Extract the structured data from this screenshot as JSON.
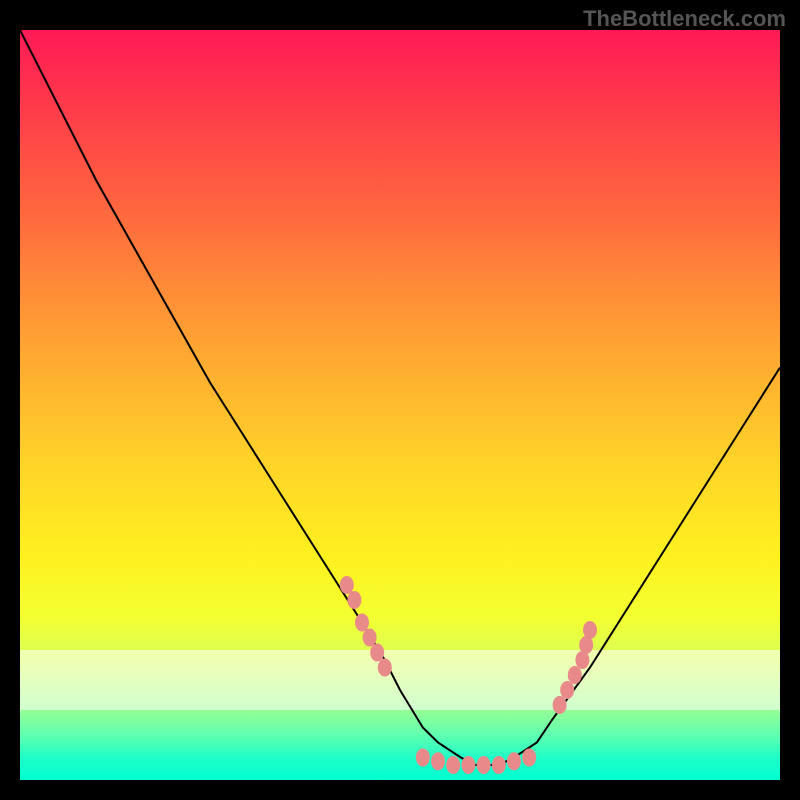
{
  "watermark": "TheBottleneck.com",
  "chart_data": {
    "type": "line",
    "title": "",
    "xlabel": "",
    "ylabel": "",
    "xlim": [
      0,
      100
    ],
    "ylim": [
      0,
      100
    ],
    "series": [
      {
        "name": "curve",
        "x": [
          0,
          5,
          10,
          15,
          20,
          25,
          30,
          35,
          40,
          45,
          48,
          50,
          53,
          55,
          58,
          60,
          63,
          65,
          68,
          70,
          75,
          80,
          85,
          90,
          95,
          100
        ],
        "y": [
          100,
          90,
          80,
          71,
          62,
          53,
          45,
          37,
          29,
          21,
          16,
          12,
          7,
          5,
          3,
          2,
          2,
          3,
          5,
          8,
          15,
          23,
          31,
          39,
          47,
          55
        ]
      }
    ],
    "marker_clusters": [
      {
        "name": "left-cluster",
        "points": [
          {
            "x": 43,
            "y": 26
          },
          {
            "x": 44,
            "y": 24
          },
          {
            "x": 45,
            "y": 21
          },
          {
            "x": 46,
            "y": 19
          },
          {
            "x": 47,
            "y": 17
          },
          {
            "x": 48,
            "y": 15
          }
        ]
      },
      {
        "name": "bottom-cluster",
        "points": [
          {
            "x": 53,
            "y": 3
          },
          {
            "x": 55,
            "y": 2.5
          },
          {
            "x": 57,
            "y": 2
          },
          {
            "x": 59,
            "y": 2
          },
          {
            "x": 61,
            "y": 2
          },
          {
            "x": 63,
            "y": 2
          },
          {
            "x": 65,
            "y": 2.5
          },
          {
            "x": 67,
            "y": 3
          }
        ]
      },
      {
        "name": "right-cluster",
        "points": [
          {
            "x": 71,
            "y": 10
          },
          {
            "x": 72,
            "y": 12
          },
          {
            "x": 73,
            "y": 14
          },
          {
            "x": 74,
            "y": 16
          },
          {
            "x": 74.5,
            "y": 18
          },
          {
            "x": 75,
            "y": 20
          }
        ]
      }
    ],
    "colors": {
      "gradient_top": "#ff1a56",
      "gradient_bottom": "#00ffd0",
      "curve": "#000000",
      "markers": "#e88a8a"
    }
  }
}
